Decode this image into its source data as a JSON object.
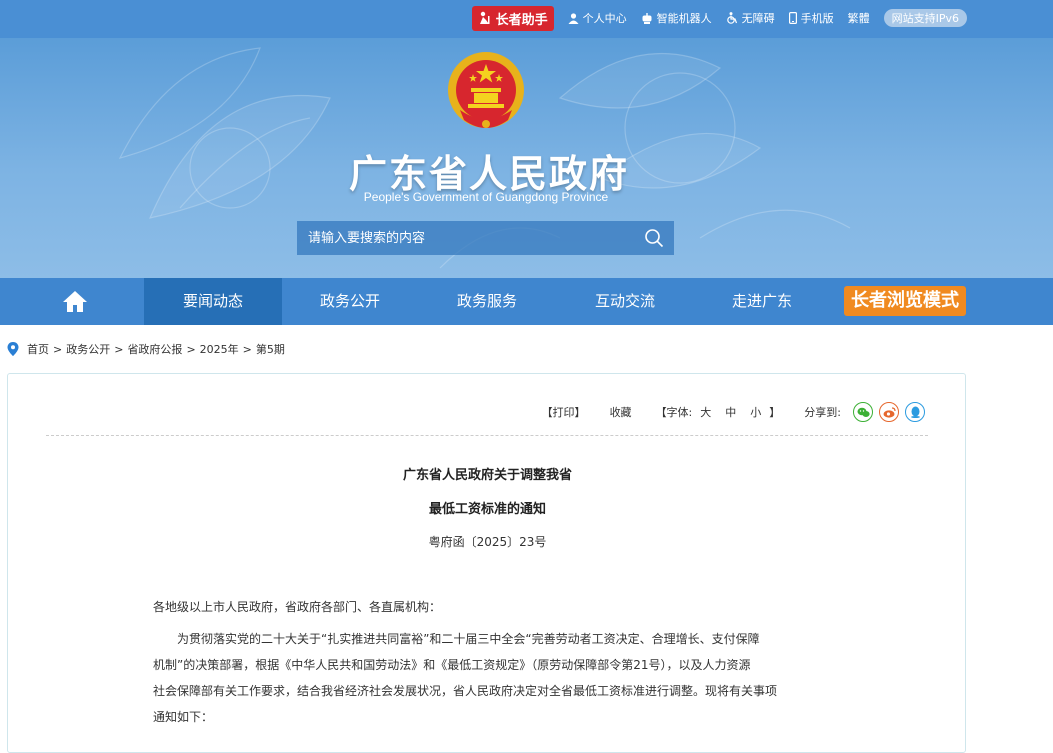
{
  "topbar": {
    "elder_helper": "长者助手",
    "personal_center": "个人中心",
    "robot": "智能机器人",
    "accessibility": "无障碍",
    "mobile": "手机版",
    "traditional": "繁體",
    "ipv6": "网站支持IPv6"
  },
  "header": {
    "title": "广东省人民政府",
    "subtitle": "People's Government of Guangdong Province",
    "search_placeholder": "请输入要搜索的内容"
  },
  "nav": {
    "tabs": [
      {
        "label": "要闻动态"
      },
      {
        "label": "政务公开"
      },
      {
        "label": "政务服务"
      },
      {
        "label": "互动交流"
      },
      {
        "label": "走进广东"
      }
    ],
    "elder_mode": "长者浏览模式"
  },
  "breadcrumb": [
    "首页",
    "政务公开",
    "省政府公报",
    "2025年",
    "第5期"
  ],
  "breadcrumb_sep": ">",
  "tools": {
    "print": "【打印】",
    "favorite": "收藏",
    "font_open": "【字体:",
    "font_large": "大",
    "font_medium": "中",
    "font_small": "小",
    "font_close": "】",
    "share_to": "分享到:"
  },
  "article": {
    "title_line1": "广东省人民政府关于调整我省",
    "title_line2": "最低工资标准的通知",
    "doc_number": "粤府函〔2025〕23号",
    "salutation": "各地级以上市人民政府，省政府各部门、各直属机构：",
    "body_lines": [
      "为贯彻落实党的二十大关于“扎实推进共同富裕”和二十届三中全会“完善劳动者工资决定、合理增长、支付保障",
      "机制”的决策部署，根据《中华人民共和国劳动法》和《最低工资规定》（原劳动保障部令第21号），以及人力资源",
      "社会保障部有关工作要求，结合我省经济社会发展状况，省人民政府决定对全省最低工资标准进行调整。现将有关事项",
      "通知如下："
    ]
  },
  "colors": {
    "topbar": "#4a8fd4",
    "nav": "#3f86cf",
    "nav_active": "#266fb6",
    "elder_red": "#d7262e",
    "elder_orange": "#f08a20"
  }
}
